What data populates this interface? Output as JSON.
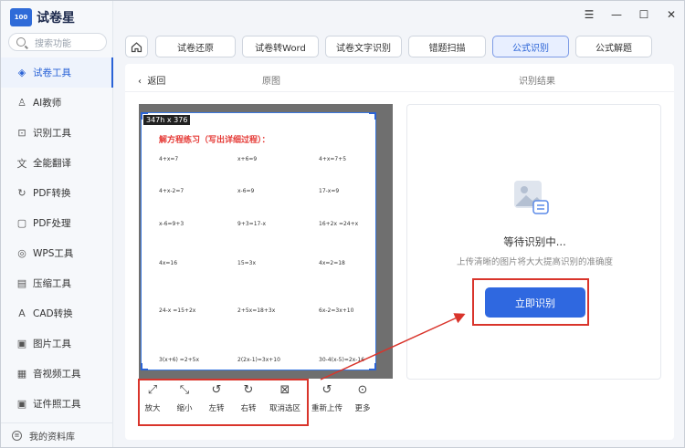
{
  "app": {
    "logo_mark": "100",
    "name": "试卷星"
  },
  "search": {
    "placeholder": "搜索功能"
  },
  "sidebar": {
    "items": [
      {
        "label": "试卷工具",
        "icon": "layers-icon",
        "active": true
      },
      {
        "label": "AI教师",
        "icon": "ai-teacher-icon"
      },
      {
        "label": "识别工具",
        "icon": "scan-icon"
      },
      {
        "label": "全能翻译",
        "icon": "translate-icon"
      },
      {
        "label": "PDF转换",
        "icon": "pdf-convert-icon"
      },
      {
        "label": "PDF处理",
        "icon": "pdf-process-icon"
      },
      {
        "label": "WPS工具",
        "icon": "wps-icon"
      },
      {
        "label": "压缩工具",
        "icon": "compress-icon"
      },
      {
        "label": "CAD转换",
        "icon": "cad-icon"
      },
      {
        "label": "图片工具",
        "icon": "image-icon"
      },
      {
        "label": "音视频工具",
        "icon": "video-icon"
      },
      {
        "label": "证件照工具",
        "icon": "id-photo-icon"
      }
    ],
    "footer": "我的资料库"
  },
  "tabs": [
    {
      "label": "试卷还原"
    },
    {
      "label": "试卷转Word"
    },
    {
      "label": "试卷文字识别"
    },
    {
      "label": "错题扫描"
    },
    {
      "label": "公式识别",
      "active": true
    },
    {
      "label": "公式解题"
    }
  ],
  "content": {
    "back": "返回",
    "original_title": "原图",
    "result_title": "识别结果",
    "selection_label": "347h x 376",
    "worksheet": {
      "title": "解方程练习（写出详细过程）：",
      "equations": [
        "4+x=7",
        "x+6=9",
        "4+x=7+5",
        "4+x-2=7",
        "x-6=9",
        "17-x=9",
        "x-6=9+3",
        "9+3=17-x",
        "16+2x =24+x",
        "4x=16",
        "15=3x",
        "4x=2=18",
        "24-x =15+2x",
        "2+5x=18+3x",
        "6x-2=3x+10",
        "3(x+6) =2+5x",
        "2(2x-1)=3x+10",
        "30-4(x-5)=2x-16"
      ]
    },
    "tools": [
      "放大",
      "缩小",
      "左转",
      "右转",
      "取消选区",
      "重新上传",
      "更多"
    ],
    "waiting_text": "等待识别中...",
    "hint_text": "上传清晰的图片将大大提高识别的准确度",
    "recognize_button": "立即识别"
  },
  "colors": {
    "accent": "#2f68e0",
    "highlight": "#d9342b",
    "worksheet_title": "#e53935"
  }
}
